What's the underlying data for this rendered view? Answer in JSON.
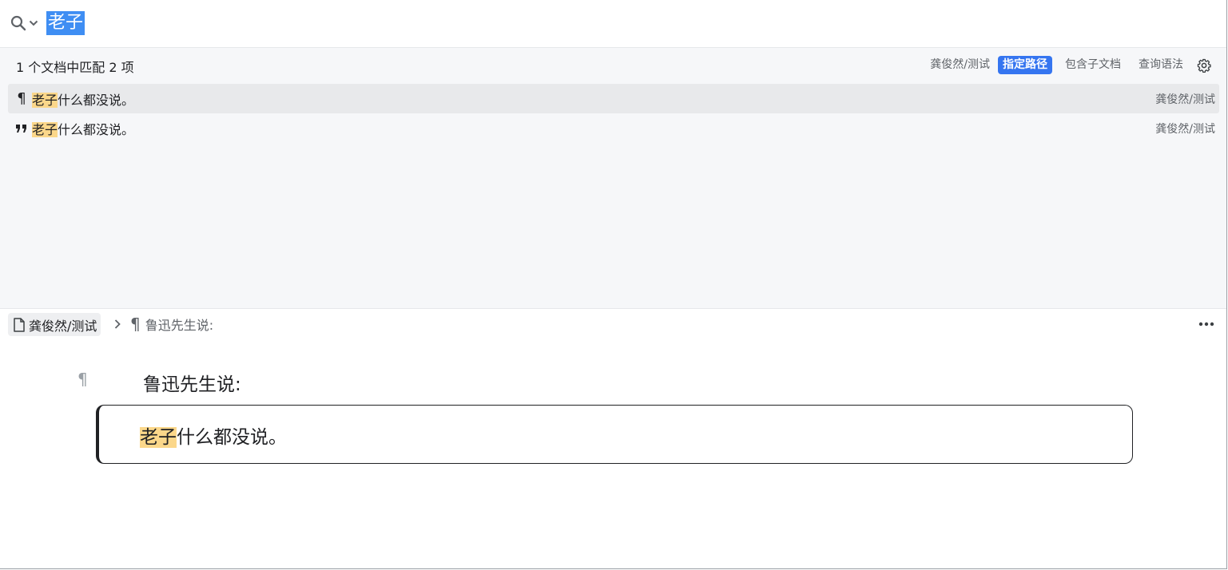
{
  "search": {
    "query": "老子",
    "icon": "search-icon"
  },
  "results": {
    "match_count": "1 个文档中匹配 2 项",
    "filters": {
      "path_label": "龚俊然/测试",
      "specify_path": "指定路径",
      "include_children": "包含子文档",
      "query_syntax": "查询语法"
    },
    "items": [
      {
        "icon": "paragraph-icon",
        "highlight": "老子",
        "rest": "什么都没说。",
        "path": "龚俊然/测试"
      },
      {
        "icon": "blockquote-icon",
        "highlight": "老子",
        "rest": "什么都没说。",
        "path": "龚俊然/测试"
      }
    ]
  },
  "breadcrumb": {
    "doc": "龚俊然/测试",
    "block": "鲁迅先生说:"
  },
  "editor": {
    "paragraph": "鲁迅先生说:",
    "quote_highlight": "老子",
    "quote_rest": "什么都没说。"
  },
  "colors": {
    "accent": "#3575f0",
    "selection": "#3f8ef3",
    "highlight": "#fbd78a",
    "panel_bg": "#f6f7f9"
  }
}
